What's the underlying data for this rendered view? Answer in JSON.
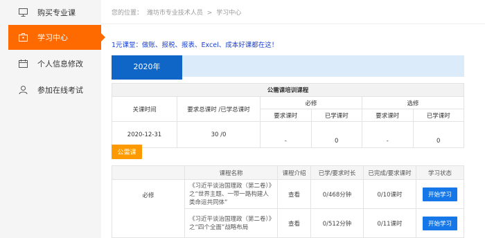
{
  "sidebar": {
    "items": [
      {
        "label": "购买专业课",
        "icon": "monitor-icon"
      },
      {
        "label": "学习中心",
        "icon": "briefcase-icon"
      },
      {
        "label": "个人信息修改",
        "icon": "calendar-icon"
      },
      {
        "label": "参加在线考试",
        "icon": "user-icon"
      }
    ],
    "active_color": "#ff6a00"
  },
  "breadcrumb": {
    "prefix": "您的位置：",
    "path": [
      "潍坊市专业技术人员",
      ">",
      "学习中心"
    ]
  },
  "promo": "1元课堂：做账、报税、报表、Excel、成本好课都在这！",
  "year_tab": "2020年",
  "summary": {
    "title": "公需课培训课程",
    "headers": {
      "deadline": "关课时间",
      "required_total": "要求总课时 /已学总课时",
      "compulsory": "必修",
      "elective": "选修",
      "req_hours": "要求课时",
      "learned_hours": "已学课时"
    },
    "row": {
      "deadline": "2020-12-31",
      "required_total": "30 /0",
      "comp_req": "-",
      "comp_learned": "0",
      "elec_req": "-",
      "elec_learned": "0"
    }
  },
  "category_tag": "公需课",
  "courses": {
    "headers": [
      "",
      "课程名称",
      "课程介绍",
      "已学/要求时长",
      "已完成/要求课时",
      "学习状态"
    ],
    "group": "必修",
    "rows": [
      {
        "name": "《习近平谈治国理政（第二卷）》之“世界主题、一带一路构建人类命运共同体”",
        "intro": "查看",
        "duration": "0/468分钟",
        "hours": "0/10课时",
        "action": "开始学习"
      },
      {
        "name": "《习近平谈治国理政（第二卷）》之“四个全面”战略布局",
        "intro": "查看",
        "duration": "0/512分钟",
        "hours": "0/11课时",
        "action": "开始学习"
      }
    ]
  }
}
